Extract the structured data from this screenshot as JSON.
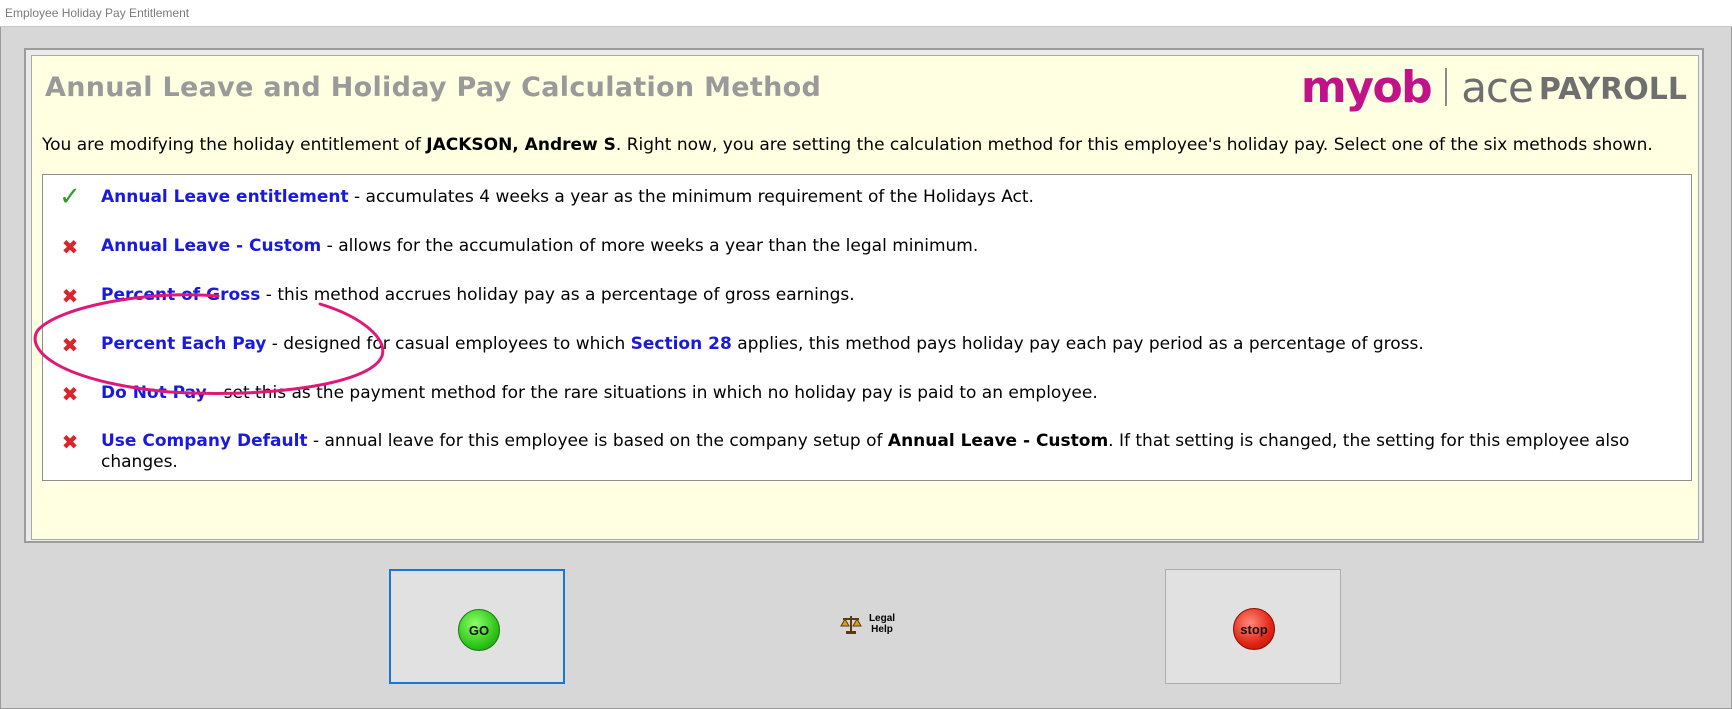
{
  "window": {
    "title": "Employee Holiday Pay Entitlement"
  },
  "panel": {
    "heading": "Annual Leave and Holiday Pay Calculation Method",
    "logo": {
      "myob": "myob",
      "ace": "ace",
      "payroll": "PAYROLL"
    }
  },
  "intro": {
    "pre": "You are modifying the holiday entitlement of ",
    "employee": "JACKSON, Andrew S",
    "post": ". Right now, you are setting the calculation method for this employee's holiday pay. Select one of the six methods shown."
  },
  "methods": [
    {
      "selected": true,
      "name": "Annual Leave entitlement",
      "desc": " - accumulates 4 weeks a year as the minimum requirement of the Holidays Act."
    },
    {
      "selected": false,
      "name": "Annual Leave - Custom",
      "desc": " - allows for the accumulation of more weeks a year than the legal minimum."
    },
    {
      "selected": false,
      "name": "Percent of Gross",
      "desc": " - this method accrues holiday pay as a percentage of gross earnings."
    },
    {
      "selected": false,
      "name": "Percent Each Pay",
      "desc_pre": " - designed for casual employees to which ",
      "section": "Section 28",
      "desc_post": " applies, this method pays holiday pay each pay period as a percentage of gross."
    },
    {
      "selected": false,
      "name": "Do Not Pay",
      "desc": " - set this as the payment method for the rare situations in which no holiday pay is paid to an employee."
    },
    {
      "selected": false,
      "name": "Use Company Default",
      "desc_pre": " - annual leave for this employee is based on the company setup of ",
      "emph": "Annual Leave - Custom",
      "desc_post": ". If that setting is changed, the setting for this employee also changes."
    }
  ],
  "buttons": {
    "go": "GO",
    "legal_line1": "Legal",
    "legal_line2": "Help",
    "stop": "stop"
  },
  "colors": {
    "panel_bg": "#ffffe1",
    "option_link": "#1a1adc",
    "check": "#2f9d2a",
    "cross": "#d9262a",
    "annotation": "#e0187a",
    "logo_magenta": "#c2128a"
  }
}
